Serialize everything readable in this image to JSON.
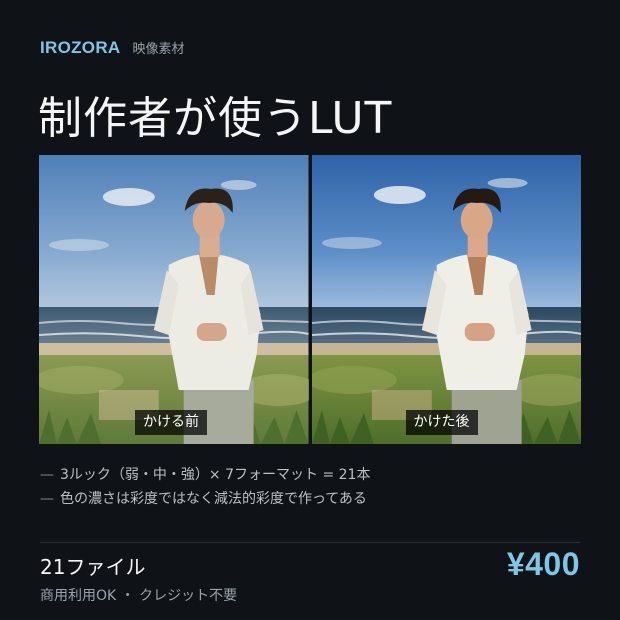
{
  "brand": {
    "name": "IROZORA",
    "subtitle": "映像素材",
    "color": "#7ec6e6"
  },
  "title": "制作者が使うLUT",
  "comparison": {
    "before_label": "かける前",
    "after_label": "かけた後"
  },
  "notes": [
    {
      "dash": "—",
      "text": "3ルック（弱・中・強）× 7フォーマット = 21本"
    },
    {
      "dash": "—",
      "text": "色の濃さは彩度ではなく減法的彩度で作ってある"
    }
  ],
  "footer": {
    "file_count": "21ファイル",
    "license": "商用利用OK ・ クレジット不要",
    "price": "¥400",
    "price_color": "#7ec6e6"
  }
}
